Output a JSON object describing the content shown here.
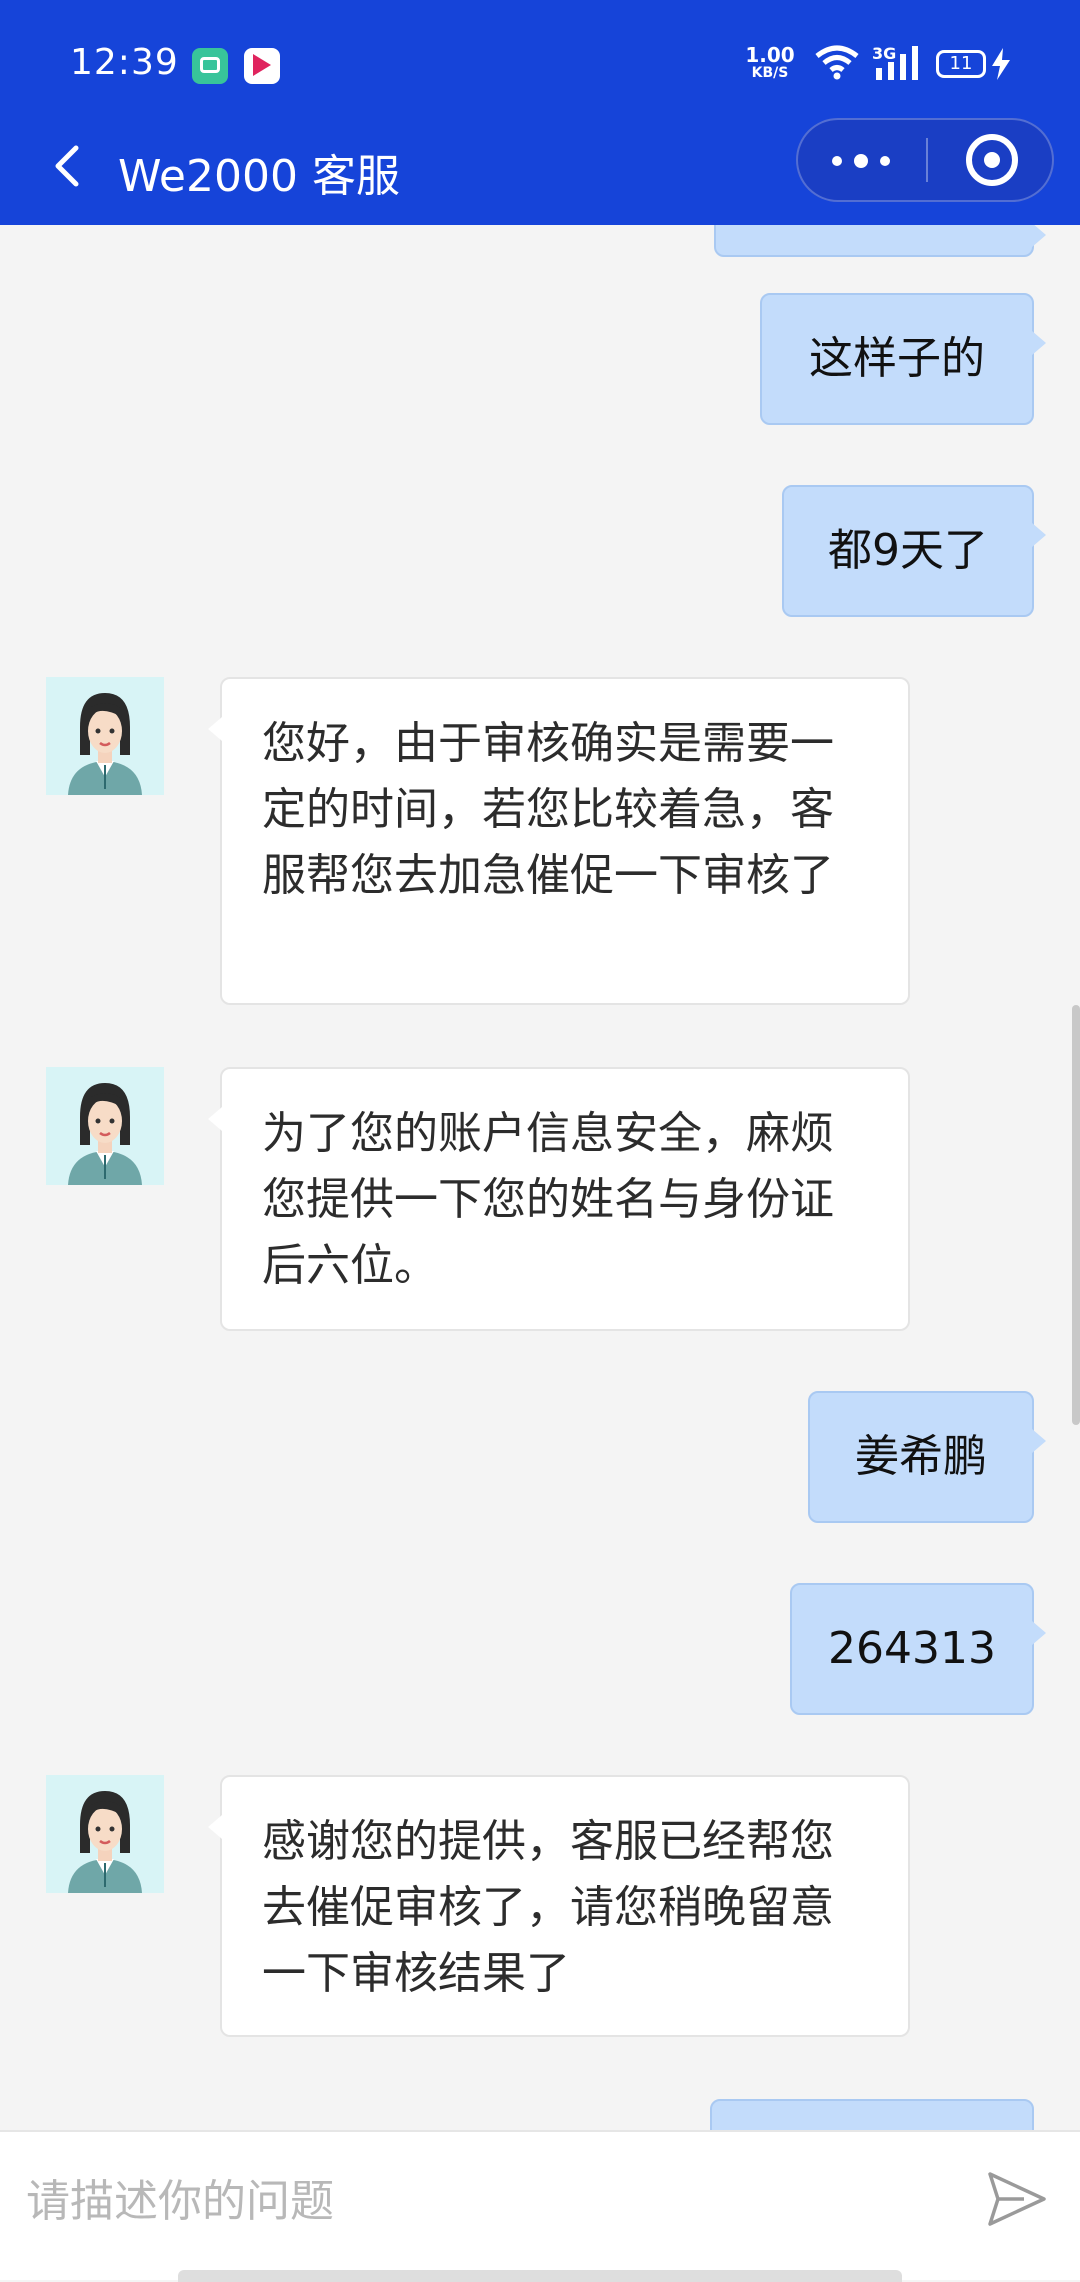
{
  "status_bar": {
    "time": "12:39",
    "net_speed_value": "1.00",
    "net_speed_unit": "KB/S",
    "network_type": "3G",
    "battery": "11",
    "icons": [
      "message-app-icon",
      "video-app-icon",
      "wifi-icon",
      "signal-icon",
      "battery-icon",
      "charging-icon"
    ]
  },
  "header": {
    "title": "We2000 客服",
    "back_icon": "chevron-left-icon",
    "more_icon": "more-dots-icon",
    "close_icon": "target-close-icon"
  },
  "messages": [
    {
      "sender": "user",
      "text": "这样子的"
    },
    {
      "sender": "user",
      "text": "都9天了"
    },
    {
      "sender": "agent",
      "text": "您好，由于审核确实是需要一定的时间，若您比较着急，客服帮您去加急催促一下审核了"
    },
    {
      "sender": "agent",
      "text": "为了您的账户信息安全，麻烦您提供一下您的姓名与身份证后六位。"
    },
    {
      "sender": "user",
      "text": "姜希鹏"
    },
    {
      "sender": "user",
      "text": "264313"
    },
    {
      "sender": "agent",
      "text": "感谢您的提供，客服已经帮您去催促审核了，请您稍晚留意一下审核结果了"
    }
  ],
  "input": {
    "placeholder": "请描述你的问题",
    "value": "",
    "send_icon": "send-icon"
  },
  "colors": {
    "header_bg": "#1644d9",
    "user_bubble": "#c3dcfb",
    "agent_bubble": "#ffffff",
    "chat_bg": "#f4f4f4"
  }
}
